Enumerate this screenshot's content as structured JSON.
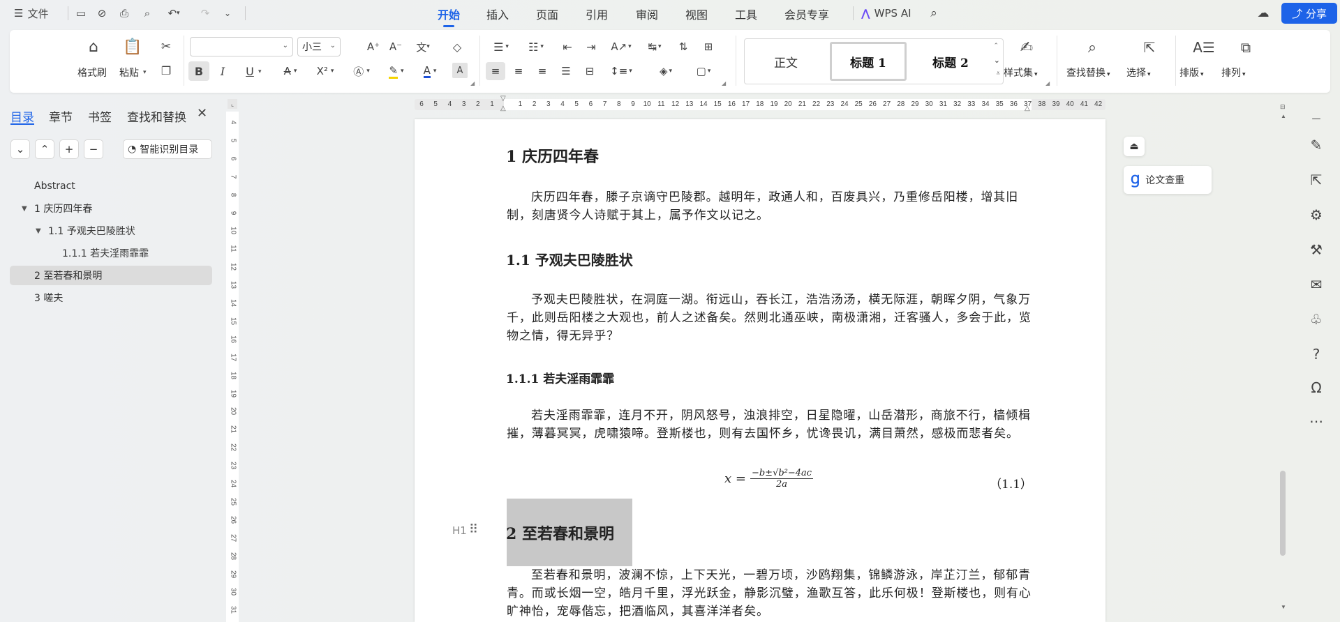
{
  "titlebar": {
    "file_label": "文件",
    "tabs": [
      "开始",
      "插入",
      "页面",
      "引用",
      "审阅",
      "视图",
      "工具",
      "会员专享"
    ],
    "wps_ai": "WPS AI",
    "share": "分享"
  },
  "ribbon": {
    "format_painter": "格式刷",
    "paste": "粘贴",
    "font_name": "",
    "font_size": "小三",
    "bold": "B",
    "italic": "I",
    "underline": "U",
    "superscript": "X²",
    "style_normal": "正文",
    "style_h1": "标题 1",
    "style_h2": "标题 2",
    "style_set": "样式集",
    "find_replace": "查找替换",
    "select": "选择",
    "layout": "排版",
    "arrange": "排列"
  },
  "nav": {
    "tabs": [
      "目录",
      "章节",
      "书签",
      "查找和替换"
    ],
    "smart_toc": "智能识别目录",
    "toc": [
      {
        "label": "Abstract"
      },
      {
        "label": "1 庆历四年春"
      },
      {
        "label": "1.1 予观夫巴陵胜状"
      },
      {
        "label": "1.1.1 若夫淫雨霏霏"
      },
      {
        "label": "2 至若春和景明"
      },
      {
        "label": "3 嗟夫"
      }
    ]
  },
  "ruler": {
    "h_numbers": [
      "6",
      "5",
      "4",
      "3",
      "2",
      "1",
      "",
      "1",
      "2",
      "3",
      "4",
      "5",
      "6",
      "7",
      "8",
      "9",
      "10",
      "11",
      "12",
      "13",
      "14",
      "15",
      "16",
      "17",
      "18",
      "19",
      "20",
      "21",
      "22",
      "23",
      "24",
      "25",
      "26",
      "27",
      "28",
      "29",
      "30",
      "31",
      "32",
      "33",
      "34",
      "35",
      "36",
      "37",
      "38",
      "39",
      "40",
      "41",
      "42"
    ],
    "v_numbers": [
      "4",
      "5",
      "6",
      "7",
      "8",
      "9",
      "10",
      "11",
      "12",
      "13",
      "14",
      "15",
      "16",
      "17",
      "18",
      "19",
      "20",
      "21",
      "22",
      "23",
      "24",
      "25",
      "26",
      "27",
      "28",
      "29",
      "30",
      "31"
    ]
  },
  "document": {
    "h1_1": "1 庆历四年春",
    "p1": "庆历四年春，滕子京谪守巴陵郡。越明年，政通人和，百废具兴，乃重修岳阳楼，增其旧制，刻唐贤今人诗赋于其上，属予作文以记之。",
    "h2_1": "1.1 予观夫巴陵胜状",
    "p2": "予观夫巴陵胜状，在洞庭一湖。衔远山，吞长江，浩浩汤汤，横无际涯，朝晖夕阴，气象万千，此则岳阳楼之大观也，前人之述备矣。然则北通巫峡，南极潇湘，迁客骚人，多会于此，览物之情，得无异乎？",
    "h3_1": "1.1.1 若夫淫雨霏霏",
    "p3": "若夫淫雨霏霏，连月不开，阴风怒号，浊浪排空，日星隐曜，山岳潜形，商旅不行，樯倾楫摧，薄暮冥冥，虎啸猿啼。登斯楼也，则有去国怀乡，忧谗畏讥，满目萧然，感极而悲者矣。",
    "formula_lhs": "x =",
    "formula_num": "−b±√b²−4ac",
    "formula_den": "2a",
    "formula_number": "（1.1）",
    "h1_2": "2 至若春和景明",
    "heading_marker": "H1",
    "p4": "至若春和景明，波澜不惊，上下天光，一碧万顷，沙鸥翔集，锦鳞游泳，岸芷汀兰，郁郁青青。而或长烟一空，皓月千里，浮光跃金，静影沉璧，渔歌互答，此乐何极！登斯楼也，则有心旷神怡，宠辱偕忘，把酒临风，其喜洋洋者矣。"
  },
  "side": {
    "paper_check": "论文查重"
  }
}
